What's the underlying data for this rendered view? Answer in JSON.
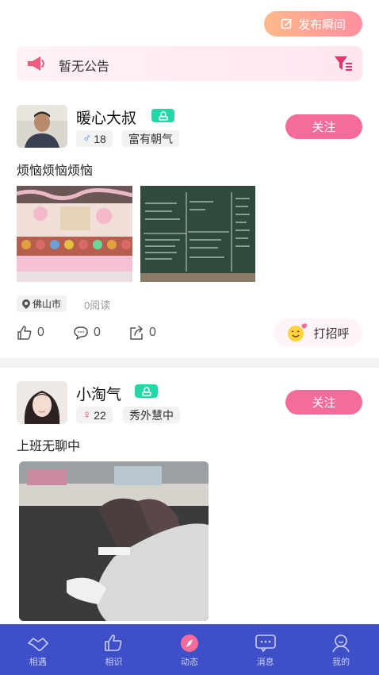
{
  "header": {
    "publish_label": "发布瞬间"
  },
  "notice": {
    "text": "暂无公告"
  },
  "posts": [
    {
      "username": "暖心大叔",
      "gender_symbol": "♂",
      "age": "18",
      "tag": "富有朝气",
      "follow_label": "关注",
      "text": "烦恼烦恼烦恼",
      "location": "佛山市",
      "reads": "0阅读",
      "likes": "0",
      "comments": "0",
      "shares": "0",
      "greet_label": "打招呼"
    },
    {
      "username": "小淘气",
      "gender_symbol": "♀",
      "age": "22",
      "tag": "秀外慧中",
      "follow_label": "关注",
      "text": "上班无聊中"
    }
  ],
  "colors": {
    "accent": "#f56b9a",
    "tabbar": "#3f4fc8",
    "badge": "#22d7a8",
    "male": "#3a8ef0",
    "female": "#f2405a"
  },
  "tabs": [
    {
      "label": "相遇",
      "icon": "handshake-icon"
    },
    {
      "label": "相识",
      "icon": "thumbs-up-icon"
    },
    {
      "label": "动态",
      "icon": "compass-icon"
    },
    {
      "label": "消息",
      "icon": "chat-icon"
    },
    {
      "label": "我的",
      "icon": "user-icon"
    }
  ]
}
